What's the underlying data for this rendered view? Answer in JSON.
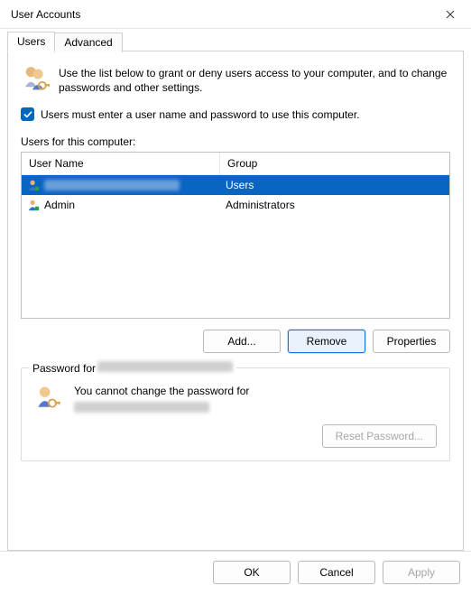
{
  "window": {
    "title": "User Accounts",
    "close_icon_name": "close-icon"
  },
  "tabs": [
    {
      "label": "Users",
      "active": true
    },
    {
      "label": "Advanced",
      "active": false
    }
  ],
  "intro_text": "Use the list below to grant or deny users access to your computer, and to change passwords and other settings.",
  "checkbox": {
    "checked": true,
    "label": "Users must enter a user name and password to use this computer."
  },
  "list": {
    "caption": "Users for this computer:",
    "columns": {
      "username": "User Name",
      "group": "Group"
    },
    "rows": [
      {
        "username": "[redacted]",
        "group": "Users",
        "selected": true,
        "redacted": true
      },
      {
        "username": "Admin",
        "group": "Administrators",
        "selected": false,
        "redacted": false
      }
    ]
  },
  "list_buttons": {
    "add": "Add...",
    "remove": "Remove",
    "properties": "Properties"
  },
  "password_group": {
    "legend_prefix": "Password for",
    "legend_user": "[redacted]",
    "body_prefix": "You cannot change the password for",
    "body_user": "[redacted]",
    "reset_label": "Reset Password..."
  },
  "footer": {
    "ok": "OK",
    "cancel": "Cancel",
    "apply": "Apply"
  }
}
